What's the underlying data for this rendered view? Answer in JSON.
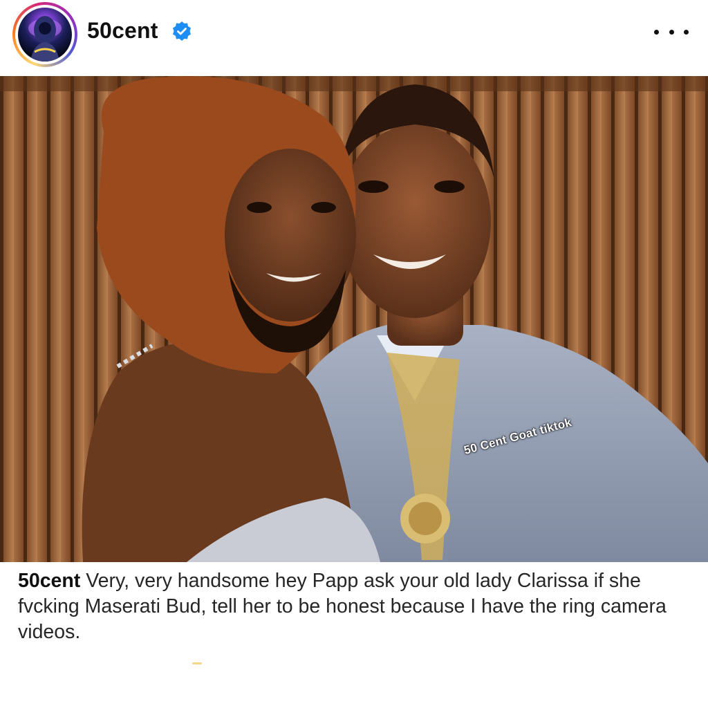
{
  "post": {
    "username": "50cent",
    "verified": true,
    "more_icon": "more-horizontal-icon",
    "image_watermark": "50 Cent Goat tiktok",
    "caption_username": "50cent",
    "caption_text": "Very, very handsome hey Papp ask your old lady Clarissa if she fvcking Maserati Bud, tell her to be honest because I have the ring camera videos."
  },
  "colors": {
    "verified_badge": "#1e8ef6",
    "text_primary": "#111111",
    "story_ring": [
      "#feda75",
      "#fa7e1e",
      "#d62976",
      "#962fbf",
      "#4f5bd5"
    ]
  }
}
